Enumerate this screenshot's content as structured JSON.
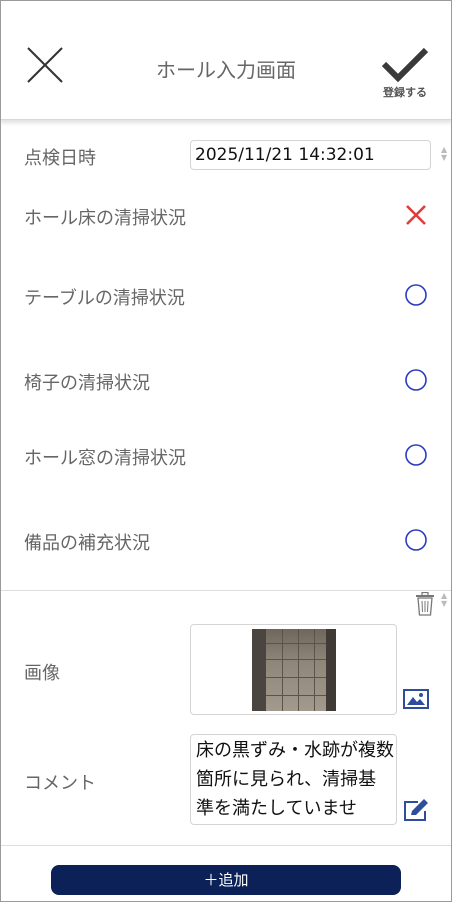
{
  "header": {
    "title": "ホール入力画面",
    "register_label": "登録する"
  },
  "form": {
    "datetime": {
      "label": "点検日時",
      "value": "2025/11/21 14:32:01"
    },
    "items": [
      {
        "label": "ホール床の清掃状況",
        "status": "ng",
        "status_icon": "cross-icon"
      },
      {
        "label": "テーブルの清掃状況",
        "status": "ok",
        "status_icon": "circle-icon"
      },
      {
        "label": "椅子の清掃状況",
        "status": "ok",
        "status_icon": "circle-icon"
      },
      {
        "label": "ホール窓の清掃状況",
        "status": "ok",
        "status_icon": "circle-icon"
      },
      {
        "label": "備品の補充状況",
        "status": "ok",
        "status_icon": "circle-icon"
      }
    ]
  },
  "entry": {
    "image_label": "画像",
    "comment_label": "コメント",
    "comment_value": "床の黒ずみ・水跡が複数箇所に見られ、清掃基準を満たしていませ"
  },
  "footer": {
    "add_label": "＋追加"
  },
  "colors": {
    "accent_navy": "#0b2158",
    "ng_red": "#e23b3b",
    "ok_blue": "#2a3cc0",
    "icon_blue": "#2f4d9c"
  }
}
